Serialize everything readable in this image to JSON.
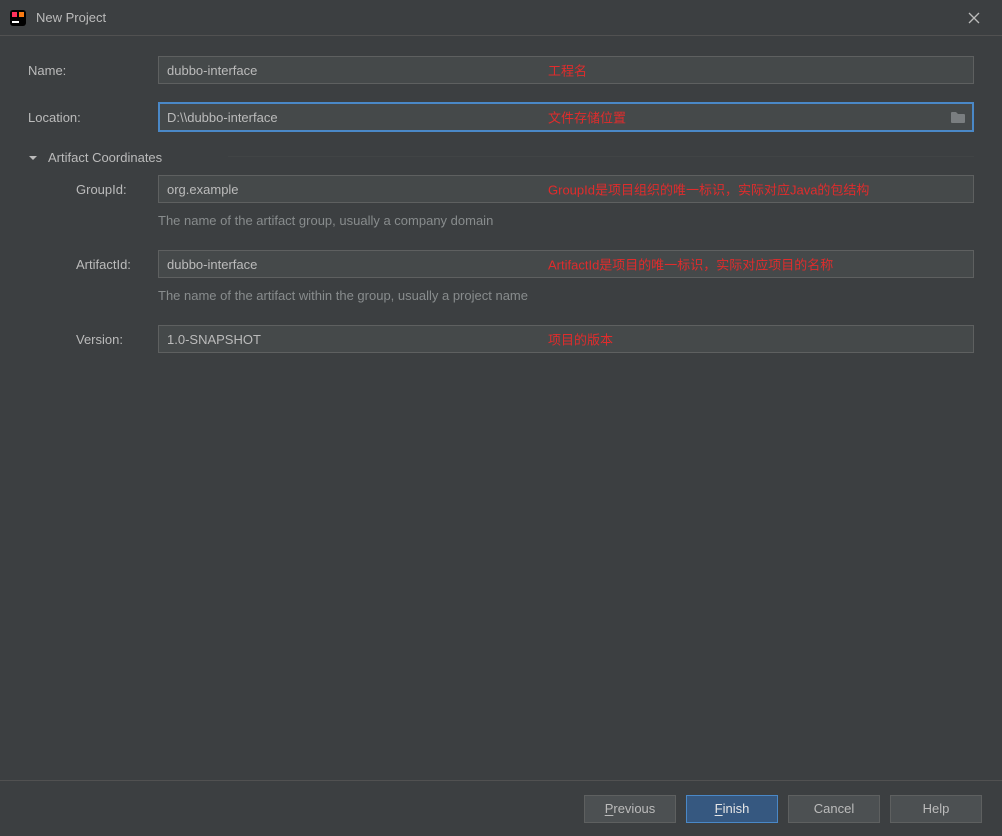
{
  "window": {
    "title": "New Project"
  },
  "fields": {
    "name_label": "Name:",
    "name_value": "dubbo-interface",
    "location_label": "Location:",
    "location_value": "D:\\\\dubbo-interface",
    "groupid_label": "GroupId:",
    "groupid_value": "org.example",
    "groupid_help": "The name of the artifact group, usually a company domain",
    "artifactid_label": "ArtifactId:",
    "artifactid_value": "dubbo-interface",
    "artifactid_help": "The name of the artifact within the group, usually a project name",
    "version_label": "Version:",
    "version_value": "1.0-SNAPSHOT"
  },
  "section": {
    "artifact_coords": "Artifact Coordinates"
  },
  "annotations": {
    "name": "工程名",
    "location": "文件存储位置",
    "groupid": "GroupId是项目组织的唯一标识，实际对应Java的包结构",
    "artifactid": "ArtifactId是项目的唯一标识，实际对应项目的名称",
    "version": "项目的版本"
  },
  "buttons": {
    "previous": "Previous",
    "finish": "Finish",
    "cancel": "Cancel",
    "help": "Help"
  }
}
